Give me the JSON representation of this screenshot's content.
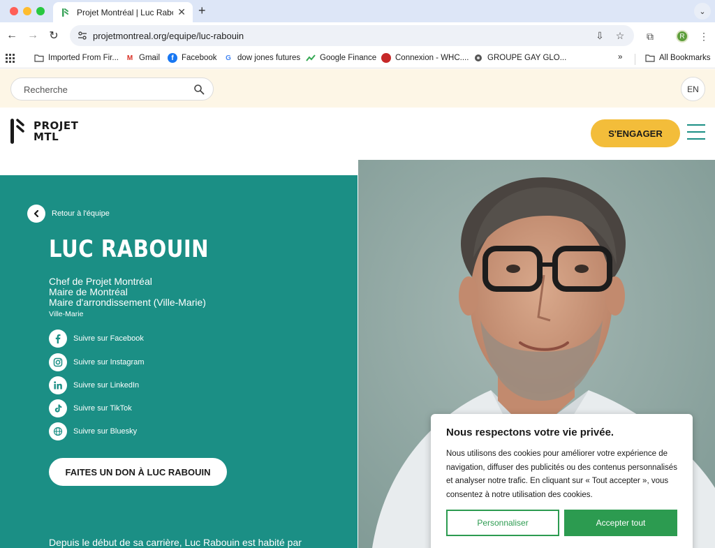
{
  "browser": {
    "tab_title": "Projet Montréal | Luc Rabouin",
    "url": "projetmontreal.org/equipe/luc-rabouin",
    "profile_initial": "R",
    "bookmarks": [
      {
        "label": "Imported From Fir...",
        "icon": "folder-icon"
      },
      {
        "label": "Gmail",
        "icon": "gmail-icon"
      },
      {
        "label": "Facebook",
        "icon": "facebook-icon"
      },
      {
        "label": "dow jones futures",
        "icon": "google-icon"
      },
      {
        "label": "Google Finance",
        "icon": "google-finance-icon"
      },
      {
        "label": "Connexion - WHC....",
        "icon": "whc-icon"
      },
      {
        "label": "GROUPE GAY GLO...",
        "icon": "site-icon"
      },
      {
        "label": "All Bookmarks",
        "icon": "folder-icon"
      }
    ],
    "overflow_label": "»"
  },
  "site": {
    "search_placeholder": "Recherche",
    "lang_toggle": "EN",
    "logo_line1": "PROJET",
    "logo_line2": "MTL",
    "engage_label": "S'ENGAGER"
  },
  "profile": {
    "back_label": "Retour à l'équipe",
    "name": "LUC RABOUIN",
    "roles": [
      "Chef de Projet Montréal",
      "Maire de Montréal",
      "Maire d'arrondissement (Ville-Marie)"
    ],
    "district": "Ville-Marie",
    "socials": [
      {
        "label": "Suivre sur Facebook",
        "icon": "facebook-icon"
      },
      {
        "label": "Suivre sur Instagram",
        "icon": "instagram-icon"
      },
      {
        "label": "Suivre sur LinkedIn",
        "icon": "linkedin-icon"
      },
      {
        "label": "Suivre sur TikTok",
        "icon": "tiktok-icon"
      },
      {
        "label": "Suivre sur Bluesky",
        "icon": "globe-icon"
      }
    ],
    "donate_label": "FAITES UN DON À LUC RABOUIN",
    "intro": "Depuis le début de sa carrière, Luc Rabouin est habité par"
  },
  "cookie": {
    "title": "Nous respectons votre vie privée.",
    "body": "Nous utilisons des cookies pour améliorer votre expérience de navigation, diffuser des publicités ou des contenus personnalisés et analyser notre trafic. En cliquant sur « Tout accepter », vous consentez à notre utilisation des cookies.",
    "customize_label": "Personnaliser",
    "accept_label": "Accepter tout"
  },
  "colors": {
    "teal": "#1b8f85",
    "yellow": "#f3bd3a",
    "cookie_green": "#2c9b50",
    "topbar_cream": "#fdf6e6"
  }
}
